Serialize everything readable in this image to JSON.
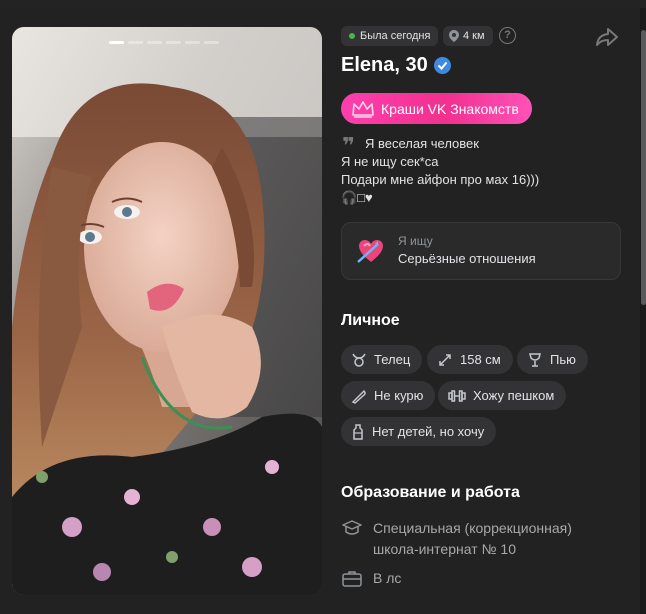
{
  "photo": {
    "dots_total": 6,
    "active_dot": 0
  },
  "profile": {
    "status": "Была сегодня",
    "distance": "4 км",
    "name_age": "Elena, 30",
    "promo_label": "Краши VK Знакомств",
    "bio_lines": [
      "Я веселая человек",
      "Я не ищу сек*са",
      "Подари мне айфон про мах 16)))",
      "🎧□♥"
    ],
    "looking_label": "Я ищу",
    "looking_value": "Серьёзные отношения"
  },
  "personal": {
    "title": "Личное",
    "tags": [
      {
        "label": "Телец",
        "icon": "taurus-icon"
      },
      {
        "label": "158 см",
        "icon": "height-icon"
      },
      {
        "label": "Пью",
        "icon": "wine-glass-icon"
      },
      {
        "label": "Не курю",
        "icon": "no-smoking-icon"
      },
      {
        "label": "Хожу пешком",
        "icon": "dumbbell-icon"
      },
      {
        "label": "Нет детей, но хочу",
        "icon": "baby-bottle-icon"
      }
    ]
  },
  "education": {
    "title": "Образование и работа",
    "school_line1": "Специальная (коррекционная)",
    "school_line2": "школа-интернат № 10",
    "job": "В лс"
  },
  "colors": {
    "promo_pink": "#f2308f",
    "verified_blue": "#3f8ae0",
    "online_green": "#4bb34b"
  }
}
